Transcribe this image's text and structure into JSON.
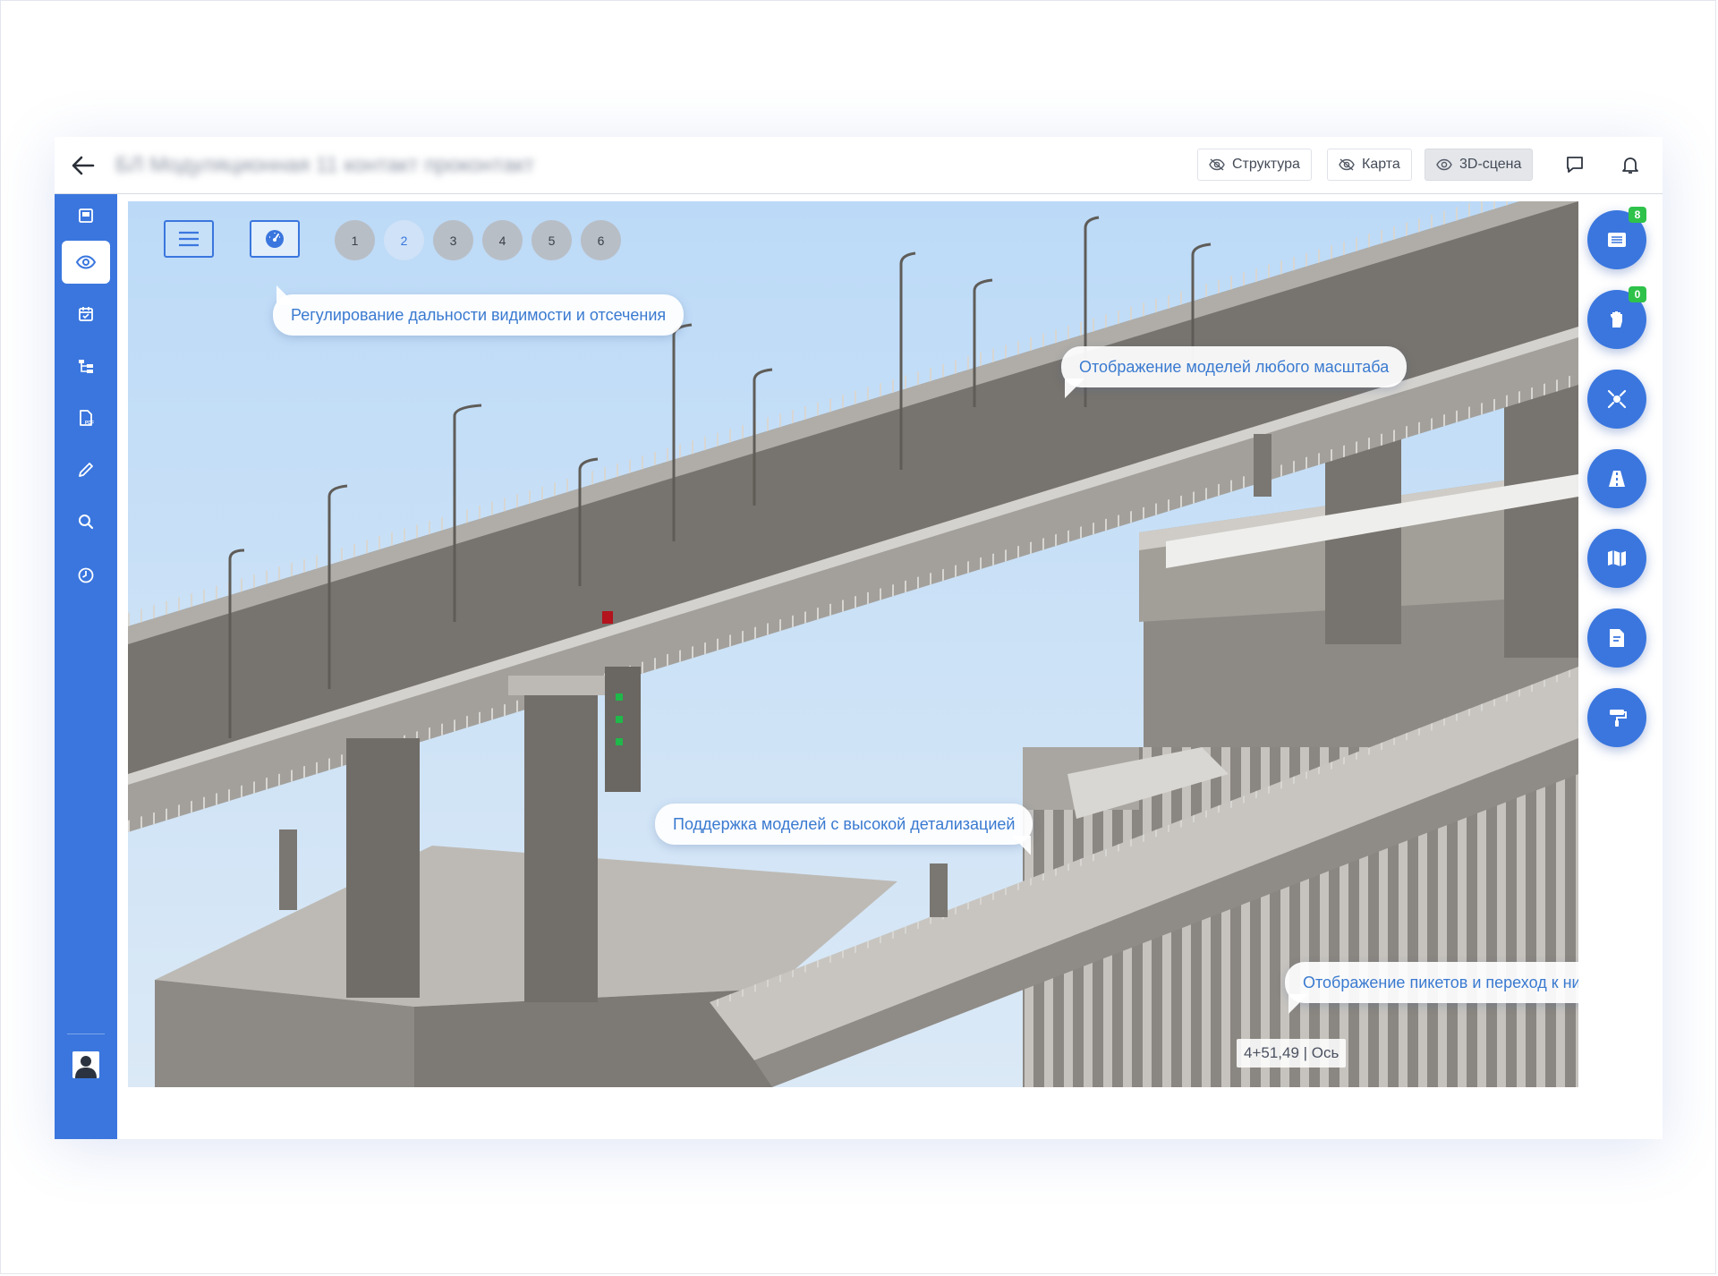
{
  "header": {
    "title": "БЛ Модуляционная 11 контакт проконтакт",
    "view_buttons": [
      {
        "label": "Структура",
        "icon": "eye-off-icon",
        "active": false
      },
      {
        "label": "Карта",
        "icon": "eye-off-icon",
        "active": false
      },
      {
        "label": "3D-сцена",
        "icon": "eye-icon",
        "active": true
      }
    ],
    "icons": [
      "chat-icon",
      "bell-icon"
    ]
  },
  "sidebar": {
    "items": [
      {
        "name": "dashboard",
        "icon": "dashboard-icon",
        "active": false
      },
      {
        "name": "view",
        "icon": "eye-icon",
        "active": true
      },
      {
        "name": "calendar",
        "icon": "calendar-check-icon",
        "active": false
      },
      {
        "name": "structure",
        "icon": "tree-structure-icon",
        "active": false
      },
      {
        "name": "pdf",
        "icon": "pdf-file-icon",
        "active": false
      },
      {
        "name": "edit",
        "icon": "pencil-icon",
        "active": false
      },
      {
        "name": "search",
        "icon": "search-icon",
        "active": false
      },
      {
        "name": "history",
        "icon": "clock-icon",
        "active": false
      }
    ],
    "user_icon": "user-avatar-icon"
  },
  "viewport": {
    "tool_buttons": [
      "menu-icon",
      "speedometer-icon"
    ],
    "number_buttons": [
      "1",
      "2",
      "3",
      "4",
      "5",
      "6"
    ],
    "active_number": "2",
    "callouts": {
      "visibility": "Регулирование дальности видимости и отсечения",
      "scale": "Отображение моделей любого масштаба",
      "detail": "Поддержка моделей с высокой детализацией",
      "pickets": "Отображение пикетов и переход к ним"
    },
    "coordinate": "4+51,49 | Ось",
    "right_buttons": [
      {
        "icon": "list-icon",
        "badge": "8"
      },
      {
        "icon": "hand-icon",
        "badge": "0"
      },
      {
        "icon": "focus-icon",
        "badge": null
      },
      {
        "icon": "road-icon",
        "badge": null
      },
      {
        "icon": "map-icon",
        "badge": null
      },
      {
        "icon": "document-icon",
        "badge": null
      },
      {
        "icon": "paint-roller-icon",
        "badge": null
      }
    ]
  },
  "colors": {
    "accent": "#3a76de",
    "sky": "#c9e1f9",
    "concrete": "#7c7873",
    "badge": "#2ec24a"
  }
}
